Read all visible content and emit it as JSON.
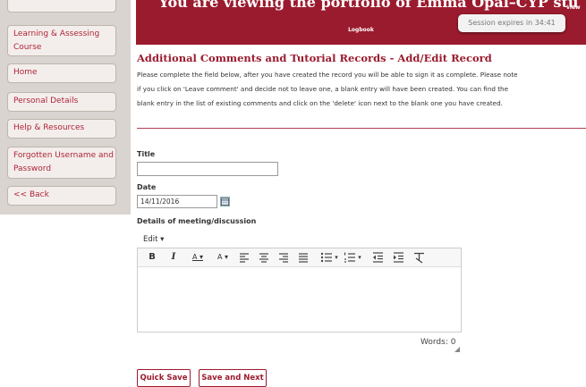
{
  "sidebar": {
    "items": [
      {
        "label": ""
      },
      {
        "label": "Learning & Assessing Course"
      },
      {
        "label": "Home"
      },
      {
        "label": "Personal Details"
      },
      {
        "label": "Help & Resources"
      },
      {
        "label": "Forgotten Username and Password"
      },
      {
        "label": "<< Back"
      }
    ]
  },
  "header": {
    "title": "You are viewing the portfolio of Emma Opal–CYP stu",
    "subtitle": "Logbook",
    "view_link": "view",
    "session": "Session expires in 34:41"
  },
  "main": {
    "page_title": "Additional Comments and Tutorial Records - Add/Edit Record",
    "instructions": [
      "Please complete the field below, after you have created the record you will be able to sign it as complete. Please note",
      "if you click on 'Leave comment' and decide not to leave one, a blank entry will have been created. You can find the",
      "blank entry in the list of existing comments and click on the 'delete' icon next to the blank one you have created."
    ],
    "title_label": "Title",
    "title_value": "",
    "date_label": "Date",
    "date_value": "14/11/2016",
    "details_label": "Details of meeting/discussion",
    "edit_menu": "Edit ▾",
    "words": "Words: 0"
  },
  "toolbar": {
    "bold": "B",
    "italic": "I",
    "font_color": "A ▾",
    "bg_color": "A ▾",
    "bullets_arrow": "▾",
    "numbers_arrow": "▾"
  },
  "buttons": {
    "quick_save": "Quick Save",
    "save_next": "Save and Next"
  },
  "colors": {
    "brand": "#9b1b2e",
    "sidebar": "#d9d4cf"
  }
}
